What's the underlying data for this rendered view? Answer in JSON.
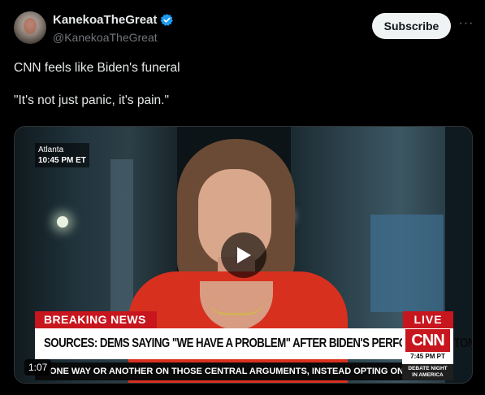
{
  "author": {
    "display_name": "KanekoaTheGreat",
    "handle": "@KanekoaTheGreat",
    "verified": true
  },
  "actions": {
    "subscribe_label": "Subscribe",
    "more_label": "···"
  },
  "tweet": {
    "lines": [
      "CNN feels like Biden's funeral",
      "\"It's not just panic, it's pain.\""
    ]
  },
  "video": {
    "duration": "1:07",
    "dateline": {
      "city": "Atlanta",
      "time": "10:45 PM ET"
    },
    "chyron": {
      "breaking_label": "BREAKING NEWS",
      "live_label": "LIVE",
      "headline": "SOURCES: DEMS SAYING \"WE HAVE A PROBLEM\" AFTER BIDEN'S PERFORMANCE TONIGHT",
      "network": "CNN",
      "network_time": "7:45 PM PT",
      "ticker": "ONE WAY OR ANOTHER ON THOSE CENTRAL ARGUMENTS, INSTEAD OPTING ONLY TO",
      "program_line1": "DEBATE NIGHT",
      "program_line2": "IN AMERICA"
    }
  },
  "colors": {
    "background": "#000000",
    "verified_badge": "#1d9bf0",
    "cnn_red": "#c8161e"
  }
}
